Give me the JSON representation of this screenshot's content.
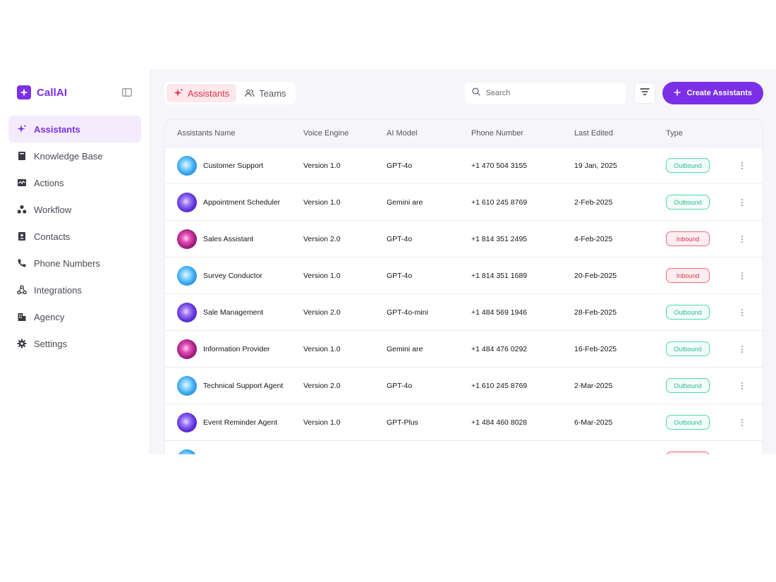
{
  "brand": {
    "name": "CallAI"
  },
  "sidebar": {
    "items": [
      {
        "label": "Assistants",
        "icon": "sparkle-icon",
        "active": true
      },
      {
        "label": "Knowledge Base",
        "icon": "book-icon"
      },
      {
        "label": "Actions",
        "icon": "activity-icon"
      },
      {
        "label": "Workflow",
        "icon": "workflow-icon"
      },
      {
        "label": "Contacts",
        "icon": "contacts-icon"
      },
      {
        "label": "Phone Numbers",
        "icon": "phone-icon"
      },
      {
        "label": "Integrations",
        "icon": "integrations-icon"
      },
      {
        "label": "Agency",
        "icon": "building-icon"
      },
      {
        "label": "Settings",
        "icon": "gear-icon"
      }
    ]
  },
  "header": {
    "tabs": [
      {
        "label": "Assistants",
        "icon": "sparkle-icon",
        "active": true
      },
      {
        "label": "Teams",
        "icon": "users-icon"
      }
    ],
    "search_placeholder": "Search",
    "create_label": "Create Assistants"
  },
  "table": {
    "columns": [
      "Assistants Name",
      "Voice Engine",
      "AI Model",
      "Phone Number",
      "Last Edited",
      "Type"
    ],
    "rows": [
      {
        "name": "Customer Support",
        "voice": "Version 1.0",
        "model": "GPT-4o",
        "phone": "+1 470 504 3155",
        "edited": "19 Jan, 2025",
        "type": "Outbound",
        "avatar": "blue"
      },
      {
        "name": "Appointment Scheduler",
        "voice": "Version 1.0",
        "model": "Gemini are",
        "phone": "+1 610 245 8769",
        "edited": "2-Feb-2025",
        "type": "Outbound",
        "avatar": "purple"
      },
      {
        "name": "Sales Assistant",
        "voice": "Version 2.0",
        "model": "GPT-4o",
        "phone": "+1 814 351 2495",
        "edited": "4-Feb-2025",
        "type": "Inbound",
        "avatar": "magenta"
      },
      {
        "name": "Survey Conductor",
        "voice": "Version 1.0",
        "model": "GPT-4o",
        "phone": "+1 814 351 1689",
        "edited": "20-Feb-2025",
        "type": "Inbound",
        "avatar": "blue"
      },
      {
        "name": "Sale Management",
        "voice": "Version 2.0",
        "model": "GPT-4o-mini",
        "phone": "+1 484 569 1946",
        "edited": "28-Feb-2025",
        "type": "Outbound",
        "avatar": "purple"
      },
      {
        "name": "Information Provider",
        "voice": "Version 1.0",
        "model": "Gemini are",
        "phone": "+1 484 476 0292",
        "edited": "16-Feb-2025",
        "type": "Outbound",
        "avatar": "magenta"
      },
      {
        "name": "Technical Support Agent",
        "voice": "Version 2.0",
        "model": "GPT-4o",
        "phone": "+1 610 245 8769",
        "edited": "2-Mar-2025",
        "type": "Outbound",
        "avatar": "blue"
      },
      {
        "name": "Event Reminder Agent",
        "voice": "Version 1.0",
        "model": "GPT-Plus",
        "phone": "+1 484 460 8028",
        "edited": "6-Mar-2025",
        "type": "Outbound",
        "avatar": "purple"
      },
      {
        "name": "",
        "voice": "",
        "model": "",
        "phone": "",
        "edited": "",
        "type": "Inbound",
        "avatar": "blue"
      }
    ]
  },
  "colors": {
    "accent": "#7b2fe6",
    "outbound": "#2bbd8a",
    "inbound": "#d9344f"
  }
}
